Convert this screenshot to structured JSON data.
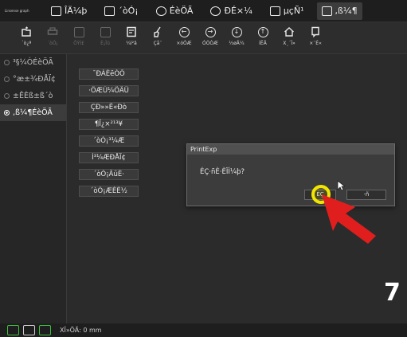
{
  "app": {
    "logo_text": "Linsense graph"
  },
  "menu": [
    {
      "label": "ÎÄ¼þ",
      "icon": "file-icon"
    },
    {
      "label": "´òÓ¡",
      "icon": "printer-icon"
    },
    {
      "label": "ÉèÖÃ",
      "icon": "settings-icon"
    },
    {
      "label": "ÐÉ×¼",
      "icon": "tools-icon"
    },
    {
      "label": "µçÑ¹",
      "icon": "power-icon"
    },
    {
      "label": ",ß¼¶",
      "icon": "advanced-icon",
      "active": true
    }
  ],
  "toolbar": [
    {
      "label": "´ò¿ª",
      "icon": "open-icon",
      "enabled": true
    },
    {
      "label": "´òÓ¡",
      "icon": "print-icon",
      "enabled": false
    },
    {
      "label": "ÔÝÍ£",
      "icon": "pause-icon",
      "enabled": false
    },
    {
      "label": "È¡Ïû",
      "icon": "cancel-icon",
      "enabled": false
    },
    {
      "label": "¼ì²â",
      "icon": "check-icon",
      "enabled": true
    },
    {
      "label": "Çå¨",
      "icon": "clean-icon",
      "enabled": true
    },
    {
      "label": "×óÒÆ",
      "icon": "left-arrow-icon",
      "enabled": true
    },
    {
      "label": "ÓÒÒÆ",
      "icon": "right-arrow-icon",
      "enabled": true
    },
    {
      "label": "½øÃ¼",
      "icon": "down-arrow-icon",
      "enabled": true
    },
    {
      "label": "ÍËÃ",
      "icon": "up-arrow-icon",
      "enabled": true
    },
    {
      "label": "X¸´Î»",
      "icon": "home-icon",
      "enabled": true
    },
    {
      "label": "×¨É«",
      "icon": "color-icon",
      "enabled": true
    }
  ],
  "sidebar": [
    {
      "label": "³§¼ÒÉèÖÃ",
      "selected": false
    },
    {
      "label": "°æ±¾ÐÅÏ¢",
      "selected": false
    },
    {
      "label": "±ÊÈß±ß´ò",
      "selected": false
    },
    {
      "label": ",ß¼¶ÉèÖÃ",
      "selected": true
    }
  ],
  "buttons": [
    "¯ÐÁÈëÒÕ",
    "·ÖÆÚ¼ÖÃÜ",
    "ÇÐ»»È«Ðò",
    "¶Ï¿×²¹³¥",
    "´òÓ¡³¼Æ",
    "Í³¼ÆÐÅÏ¢",
    "´òÓ¡ÂüÈ·",
    "´òÓ¡ÆÈÈ½"
  ],
  "dialog": {
    "title": "PrintExp",
    "message": "ÉÇ·ñÈ·ÈÏÍ¼þ?",
    "ok_label": "ÉÇ",
    "cancel_label": "·ñ"
  },
  "step_number": "7",
  "status": {
    "text": "XÎ»ÖÃ: 0 mm"
  },
  "colors": {
    "highlight": "#f2e600",
    "arrow": "#e01e1e"
  }
}
